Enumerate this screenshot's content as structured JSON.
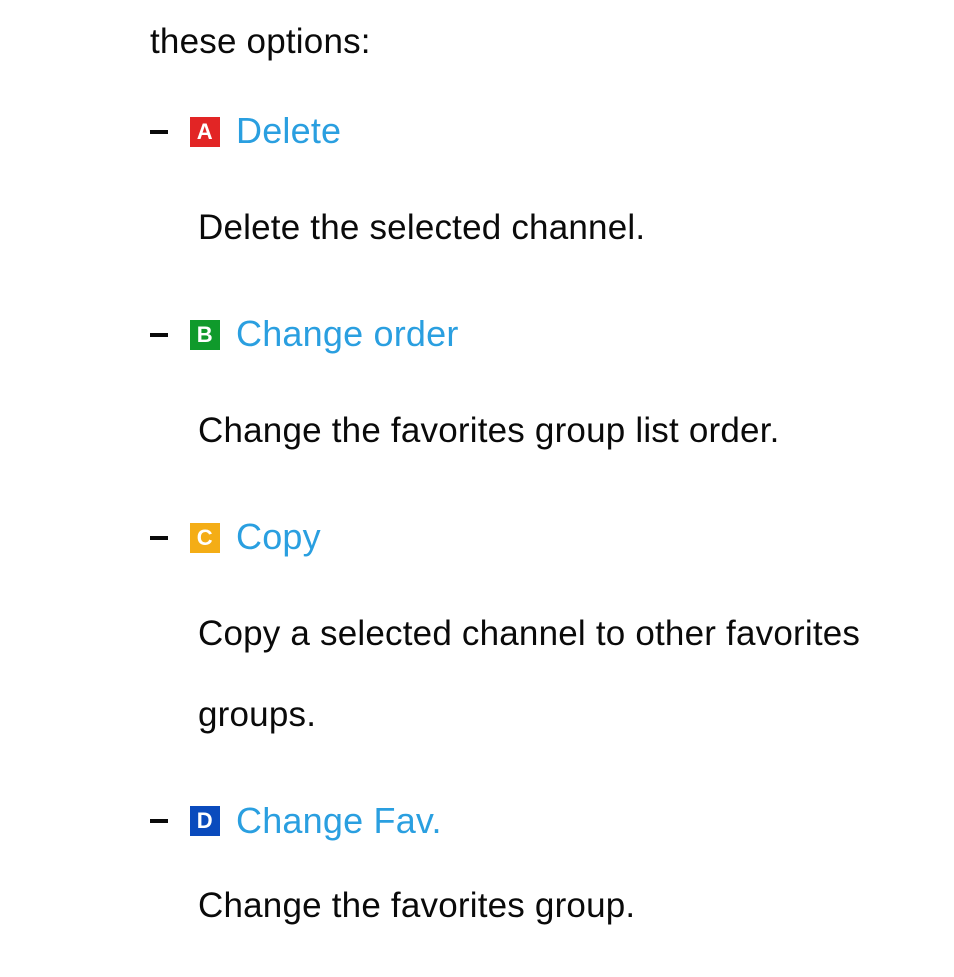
{
  "intro": "these options:",
  "options": [
    {
      "letter": "A",
      "badge_class": "badge-a",
      "title": "Delete",
      "description": "Delete the selected channel."
    },
    {
      "letter": "B",
      "badge_class": "badge-b",
      "title": "Change order",
      "description": "Change the favorites group list order."
    },
    {
      "letter": "C",
      "badge_class": "badge-c",
      "title": "Copy",
      "description": "Copy a selected channel to other favorites groups."
    },
    {
      "letter": "D",
      "badge_class": "badge-d",
      "title": "Change Fav.",
      "description": "Change the favorites group."
    }
  ]
}
